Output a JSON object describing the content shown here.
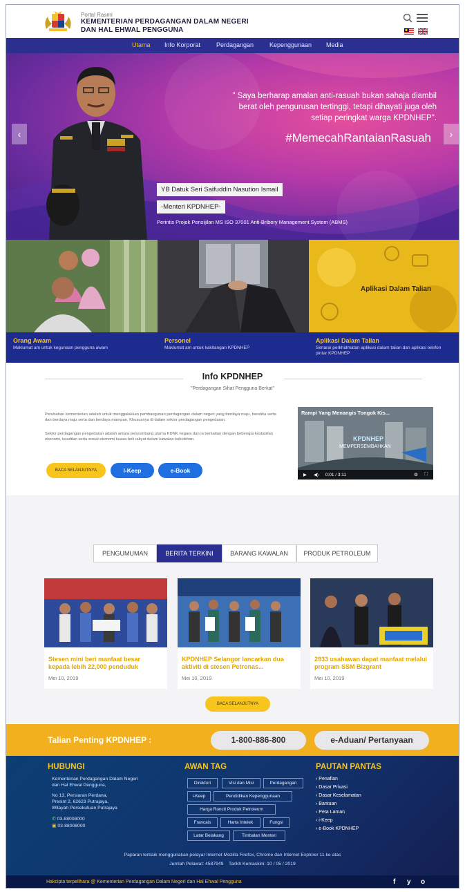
{
  "header": {
    "portal": "Portal Rasmi",
    "title_line1": "KEMENTERIAN PERDAGANGAN DALAM NEGERI",
    "title_line2": "DAN HAL EHWAL PENGGUNA"
  },
  "nav": [
    "Utama",
    "Info Korporat",
    "Perdagangan",
    "Kepenggunaan",
    "Media"
  ],
  "hero": {
    "quote": "\" Saya berharap amalan anti-rasuah bukan sahaja diambil berat oleh pengurusan tertinggi, tetapi dihayati juga oleh setiap peringkat warga KPDNHEP\".",
    "hashtag": "#MemecahRantaianRasuah",
    "name": "YB Datuk Seri Saifuddin Nasution Ismail",
    "role": "-Menteri KPDNHEP-",
    "caption": "Perintis Projek Pensijilan MS ISO 37001 Anti-Bribery Management System (ABMS)"
  },
  "tiles": [
    {
      "title": "Orang Awam",
      "desc": "Maklumat am untuk kegunaan pengguna awam"
    },
    {
      "title": "Personel",
      "desc": "Maklumat am untuk kakitangan KPDNHEP"
    },
    {
      "title": "Aplikasi Dalam Talian",
      "desc": "Senarai perkhidmatan aplikasi dalam talian dan aplikasi telefon pintar KPDNHEP",
      "overlay": "Aplikasi Dalam Talian"
    }
  ],
  "info": {
    "title": "Info KPDNHEP",
    "subtitle": "\"Perdagangan Sihat Pengguna Berkat\"",
    "p1": "Perubahan kementerian adalah untuk menggalakkan pembangunan perdagangan dalam negeri yang berdaya maju, beretika serta dan berdaya maju serta dan berdaya mampan. Khususnya di dalam sektor perdagangan pengedaran.",
    "p2": "Sektor perdagangan pengedaran adalah antara penyumbang utama KDNK negara dan ia berkaitan dengan beberapa kestabilan ekonomi, keadilan serta sosial ekonomi kuasa beli rakyat dalam kawalan kebolehan.",
    "btn_more": "BACA SELANJUTNYA",
    "btn_ikeep": "I-Keep",
    "btn_ebook": "e-Book",
    "video_title": "Rampi Yang Menangis Tongok Kis...",
    "video_brand": "KPDNHEP",
    "video_caption": "MEMPERSEMBAHKAN",
    "video_time": "0:01 / 3:11"
  },
  "news": {
    "tabs": [
      "PENGUMUMAN",
      "BERITA TERKINI",
      "BARANG KAWALAN",
      "PRODUK PETROLEUM"
    ],
    "active_tab": "BERITA TERKINI",
    "cards": [
      {
        "title": "Stesen mini beri manfaat besar kepada lebih 22,000 penduduk",
        "date": "Mei 10, 2019"
      },
      {
        "title": "KPDNHEP Selangor lancarkan dua aktiviti di stesen Petronas...",
        "date": "Mei 10, 2019"
      },
      {
        "title": "2933 usahawan dapat manfaat melalui program SSM Bizgrant",
        "date": "Mei 10, 2019"
      }
    ],
    "more": "BACA SELANJUTNYA"
  },
  "hotline": {
    "label": "Talian Penting KPDNHEP :",
    "phone": "1-800-886-800",
    "aduan": "e-Aduan/ Pertanyaan"
  },
  "footer": {
    "contact_head": "HUBUNGI",
    "contact_org1": "Kementerian Perdagangan Dalam Negeri",
    "contact_org2": "dan Hal Ehwal Pengguna,",
    "addr1": "No 13, Persiaran Perdana,",
    "addr2": "Presint 2, 62623 Putrajaya,",
    "addr3": "Wilayah Persekutuan Putrajaya",
    "phone": "03-88008000",
    "fax": "03-88008000",
    "tags_head": "AWAN TAG",
    "tags": [
      "Direktori",
      "Visi dan Misi",
      "Perdagangan",
      "i-Keep",
      "Pendidikan Kepenggunaan",
      "Harga Runcit Produk Petroleum",
      "Francais",
      "Harta Intelek",
      "Fungsi",
      "Latar Belakang",
      "Timbalan Menteri"
    ],
    "links_head": "PAUTAN PANTAS",
    "links": [
      "Penafian",
      "Dasar Privasi",
      "Dasar Keselamatan",
      "Bantuan",
      "Peta Laman",
      "i-Keep",
      "e-Book KPDNHEP"
    ],
    "note": "Paparan terbaik menggunakan pelayar Internet Mozilla Firefox, Chrome dan Internet Explorer 11 ke atas",
    "visitors": "Jumlah Pelawat: 4587949",
    "updated": "Tarikh Kemaskini: 10 / 05 / 2019",
    "copyright": "Hakcipta terpelihara @ Kementerian Perdagangan Dalam Negeri dan Hal Ehwal Pengguna",
    "social": [
      "f",
      "y",
      "o"
    ]
  },
  "colors": {
    "navy": "#2b2f8f",
    "gold": "#f7c51e",
    "hero_pink": "#e54e9d",
    "button_blue": "#1f6fe0"
  }
}
